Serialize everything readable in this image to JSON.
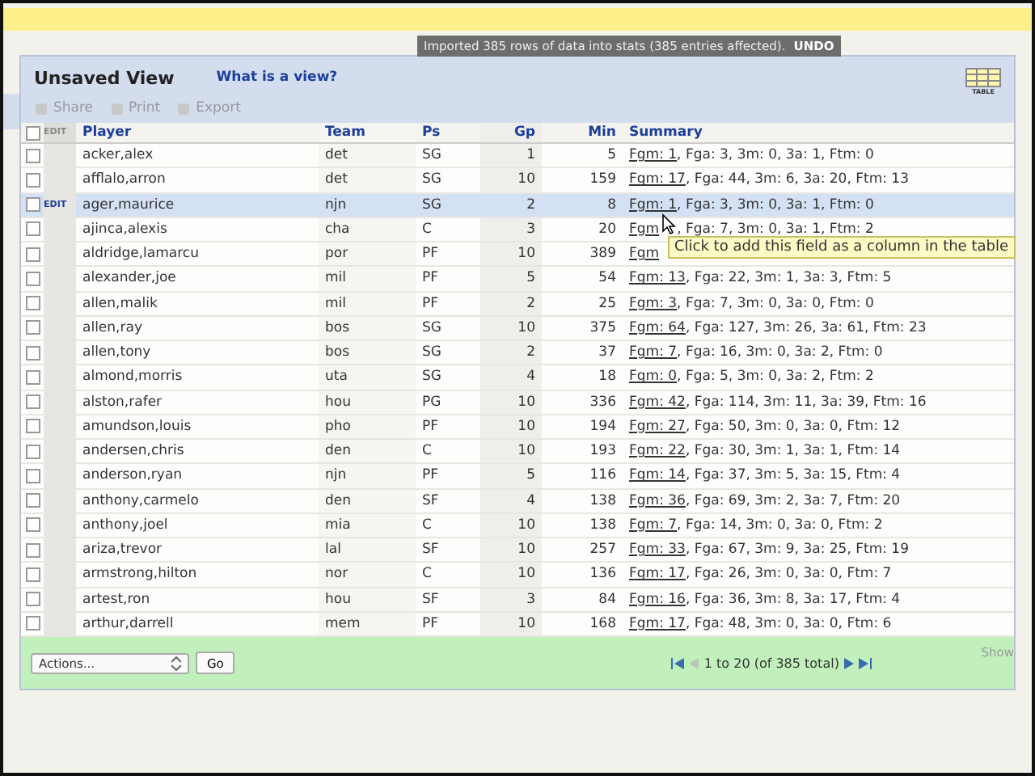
{
  "notice": {
    "message": "Imported 385 rows of data into stats (385 entries affected).",
    "action": "UNDO"
  },
  "view": {
    "title": "Unsaved View",
    "help_link": "What is a view?",
    "table_icon_label": "TABLE"
  },
  "toolbar": [
    {
      "label": "Share",
      "disabled": true
    },
    {
      "label": "Print",
      "disabled": true
    },
    {
      "label": "Export",
      "disabled": true
    }
  ],
  "table": {
    "select_all_checked": false,
    "edit_header": "EDIT",
    "columns": [
      "Player",
      "Team",
      "Ps",
      "Gp",
      "Min",
      "Summary"
    ],
    "rows": [
      {
        "player": "acker,alex",
        "team": "det",
        "ps": "SG",
        "gp": "1",
        "min": "5",
        "fgm": "Fgm: 1",
        "rest": ", Fga: 3, 3m: 0, 3a: 1, Ftm: 0",
        "checked": false,
        "highlighted": false
      },
      {
        "player": "afflalo,arron",
        "team": "det",
        "ps": "SG",
        "gp": "10",
        "min": "159",
        "fgm": "Fgm: 17",
        "rest": ", Fga: 44, 3m: 6, 3a: 20, Ftm: 13",
        "checked": false,
        "highlighted": false
      },
      {
        "player": "ager,maurice",
        "team": "njn",
        "ps": "SG",
        "gp": "2",
        "min": "8",
        "fgm": "Fgm: 1",
        "rest": ", Fga: 3, 3m: 0, 3a: 1, Ftm: 0",
        "checked": false,
        "highlighted": true,
        "edit": "EDIT"
      },
      {
        "player": "ajinca,alexis",
        "team": "cha",
        "ps": "C",
        "gp": "3",
        "min": "20",
        "fgm": "Fgm",
        "rest": ", Fga: 7, 3m: 0, 3a: 1, Ftm: 2",
        "checked": false,
        "highlighted": false
      },
      {
        "player": "aldridge,lamarcu",
        "team": "por",
        "ps": "PF",
        "gp": "10",
        "min": "389",
        "fgm": "Fgm",
        "rest": "",
        "checked": false,
        "highlighted": false
      },
      {
        "player": "alexander,joe",
        "team": "mil",
        "ps": "PF",
        "gp": "5",
        "min": "54",
        "fgm": "Fgm: 13",
        "rest": ", Fga: 22, 3m: 1, 3a: 3, Ftm: 5",
        "checked": false,
        "highlighted": false
      },
      {
        "player": "allen,malik",
        "team": "mil",
        "ps": "PF",
        "gp": "2",
        "min": "25",
        "fgm": "Fgm: 3",
        "rest": ", Fga: 7, 3m: 0, 3a: 0, Ftm: 0",
        "checked": false,
        "highlighted": false
      },
      {
        "player": "allen,ray",
        "team": "bos",
        "ps": "SG",
        "gp": "10",
        "min": "375",
        "fgm": "Fgm: 64",
        "rest": ", Fga: 127, 3m: 26, 3a: 61, Ftm: 23",
        "checked": false,
        "highlighted": false
      },
      {
        "player": "allen,tony",
        "team": "bos",
        "ps": "SG",
        "gp": "2",
        "min": "37",
        "fgm": "Fgm: 7",
        "rest": ", Fga: 16, 3m: 0, 3a: 2, Ftm: 0",
        "checked": false,
        "highlighted": false
      },
      {
        "player": "almond,morris",
        "team": "uta",
        "ps": "SG",
        "gp": "4",
        "min": "18",
        "fgm": "Fgm: 0",
        "rest": ", Fga: 5, 3m: 0, 3a: 2, Ftm: 2",
        "checked": false,
        "highlighted": false
      },
      {
        "player": "alston,rafer",
        "team": "hou",
        "ps": "PG",
        "gp": "10",
        "min": "336",
        "fgm": "Fgm: 42",
        "rest": ", Fga: 114, 3m: 11, 3a: 39, Ftm: 16",
        "checked": false,
        "highlighted": false
      },
      {
        "player": "amundson,louis",
        "team": "pho",
        "ps": "PF",
        "gp": "10",
        "min": "194",
        "fgm": "Fgm: 27",
        "rest": ", Fga: 50, 3m: 0, 3a: 0, Ftm: 12",
        "checked": false,
        "highlighted": false
      },
      {
        "player": "andersen,chris",
        "team": "den",
        "ps": "C",
        "gp": "10",
        "min": "193",
        "fgm": "Fgm: 22",
        "rest": ", Fga: 30, 3m: 1, 3a: 1, Ftm: 14",
        "checked": false,
        "highlighted": false
      },
      {
        "player": "anderson,ryan",
        "team": "njn",
        "ps": "PF",
        "gp": "5",
        "min": "116",
        "fgm": "Fgm: 14",
        "rest": ", Fga: 37, 3m: 5, 3a: 15, Ftm: 4",
        "checked": false,
        "highlighted": false
      },
      {
        "player": "anthony,carmelo",
        "team": "den",
        "ps": "SF",
        "gp": "4",
        "min": "138",
        "fgm": "Fgm: 36",
        "rest": ", Fga: 69, 3m: 2, 3a: 7, Ftm: 20",
        "checked": false,
        "highlighted": false
      },
      {
        "player": "anthony,joel",
        "team": "mia",
        "ps": "C",
        "gp": "10",
        "min": "138",
        "fgm": "Fgm: 7",
        "rest": ", Fga: 14, 3m: 0, 3a: 0, Ftm: 2",
        "checked": false,
        "highlighted": false
      },
      {
        "player": "ariza,trevor",
        "team": "lal",
        "ps": "SF",
        "gp": "10",
        "min": "257",
        "fgm": "Fgm: 33",
        "rest": ", Fga: 67, 3m: 9, 3a: 25, Ftm: 19",
        "checked": false,
        "highlighted": false
      },
      {
        "player": "armstrong,hilton",
        "team": "nor",
        "ps": "C",
        "gp": "10",
        "min": "136",
        "fgm": "Fgm: 17",
        "rest": ", Fga: 26, 3m: 0, 3a: 0, Ftm: 7",
        "checked": false,
        "highlighted": false
      },
      {
        "player": "artest,ron",
        "team": "hou",
        "ps": "SF",
        "gp": "3",
        "min": "84",
        "fgm": "Fgm: 16",
        "rest": ", Fga: 36, 3m: 8, 3a: 17, Ftm: 4",
        "checked": false,
        "highlighted": false
      },
      {
        "player": "arthur,darrell",
        "team": "mem",
        "ps": "PF",
        "gp": "10",
        "min": "168",
        "fgm": "Fgm: 17",
        "rest": ", Fga: 48, 3m: 0, 3a: 0, Ftm: 6",
        "checked": false,
        "highlighted": false
      }
    ]
  },
  "tooltip": "Click to add this field as a column in the table",
  "footer": {
    "actions_select": "Actions...",
    "go_button": "Go",
    "pagination": "1 to 20 (of 385 total)",
    "show_label": "Show"
  }
}
